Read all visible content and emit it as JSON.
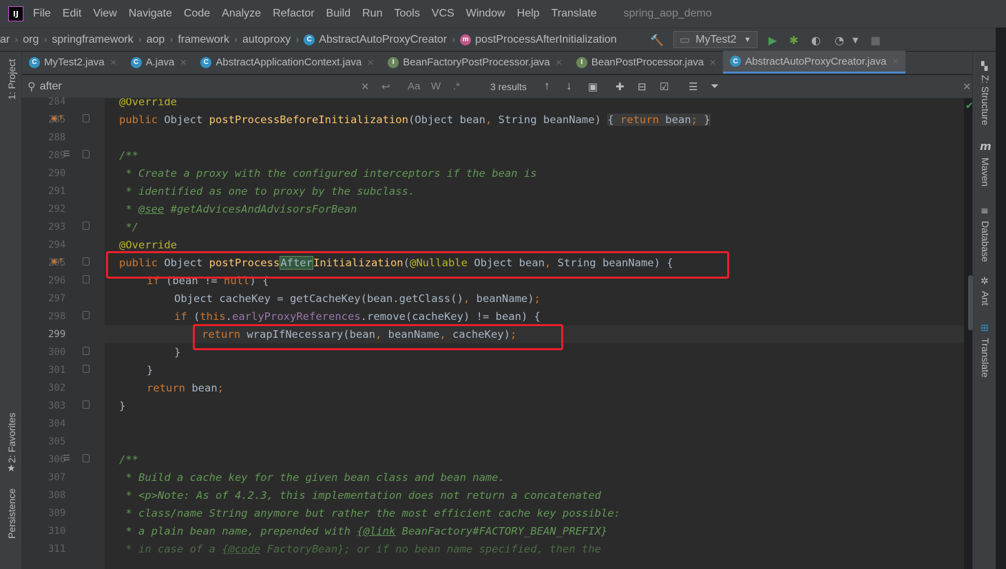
{
  "menu": {
    "items": [
      "File",
      "Edit",
      "View",
      "Navigate",
      "Code",
      "Analyze",
      "Refactor",
      "Build",
      "Run",
      "Tools",
      "VCS",
      "Window",
      "Help",
      "Translate"
    ],
    "project_title": "spring_aop_demo",
    "logo": "IJ"
  },
  "breadcrumbs": {
    "items": [
      "ar",
      "org",
      "springframework",
      "aop",
      "framework",
      "autoproxy",
      "AbstractAutoProxyCreator",
      "postProcessAfterInitialization"
    ],
    "run_config": "MyTest2"
  },
  "tabs": [
    {
      "label": "MyTest2.java",
      "icon": "class-icon",
      "active": false
    },
    {
      "label": "A.java",
      "icon": "class-icon",
      "active": false
    },
    {
      "label": "AbstractApplicationContext.java",
      "icon": "class-icon",
      "active": false
    },
    {
      "label": "BeanFactoryPostProcessor.java",
      "icon": "interface-icon",
      "active": false
    },
    {
      "label": "BeanPostProcessor.java",
      "icon": "interface-icon",
      "active": false
    },
    {
      "label": "AbstractAutoProxyCreator.java",
      "icon": "class-icon",
      "active": true
    }
  ],
  "search": {
    "value": "after",
    "results": "3 results",
    "match_case": "Aa",
    "words": "W",
    "regex": ".*"
  },
  "left_tools": {
    "project": "1: Project",
    "favorites": "2: Favorites",
    "persistence": "Persistence"
  },
  "right_tools": {
    "structure": "Z: Structure",
    "maven": "Maven",
    "database": "Database",
    "ant": "Ant",
    "translate": "Translate"
  },
  "code": {
    "current_line": 299,
    "lines": [
      {
        "n": "284",
        "text": "@Override"
      },
      {
        "n": "285",
        "text": "public Object postProcessBeforeInitialization(Object bean, String beanName) { return bean; }"
      },
      {
        "n": "288",
        "text": ""
      },
      {
        "n": "289",
        "text": "/**"
      },
      {
        "n": "290",
        "text": " * Create a proxy with the configured interceptors if the bean is"
      },
      {
        "n": "291",
        "text": " * identified as one to proxy by the subclass."
      },
      {
        "n": "292",
        "text": " * @see #getAdvicesAndAdvisorsForBean"
      },
      {
        "n": "293",
        "text": " */"
      },
      {
        "n": "294",
        "text": "@Override"
      },
      {
        "n": "295",
        "text": "public Object postProcessAfterInitialization(@Nullable Object bean, String beanName) {"
      },
      {
        "n": "296",
        "text": "if (bean != null) {"
      },
      {
        "n": "297",
        "text": "Object cacheKey = getCacheKey(bean.getClass(), beanName);"
      },
      {
        "n": "298",
        "text": "if (this.earlyProxyReferences.remove(cacheKey) != bean) {"
      },
      {
        "n": "299",
        "text": "return wrapIfNecessary(bean, beanName, cacheKey);"
      },
      {
        "n": "300",
        "text": "}"
      },
      {
        "n": "301",
        "text": "}"
      },
      {
        "n": "302",
        "text": "return bean;"
      },
      {
        "n": "303",
        "text": "}"
      },
      {
        "n": "304",
        "text": ""
      },
      {
        "n": "305",
        "text": ""
      },
      {
        "n": "306",
        "text": "/**"
      },
      {
        "n": "307",
        "text": " * Build a cache key for the given bean class and bean name."
      },
      {
        "n": "308",
        "text": " * <p>Note: As of 4.2.3, this implementation does not return a concatenated"
      },
      {
        "n": "309",
        "text": " * class/name String anymore but rather the most efficient cache key possible:"
      },
      {
        "n": "310",
        "text": " * a plain bean name, prepended with {@link BeanFactory#FACTORY_BEAN_PREFIX}"
      },
      {
        "n": "311",
        "text": " * in case of a {@code FactoryBean}; or if no bean name specified, then the"
      }
    ]
  }
}
